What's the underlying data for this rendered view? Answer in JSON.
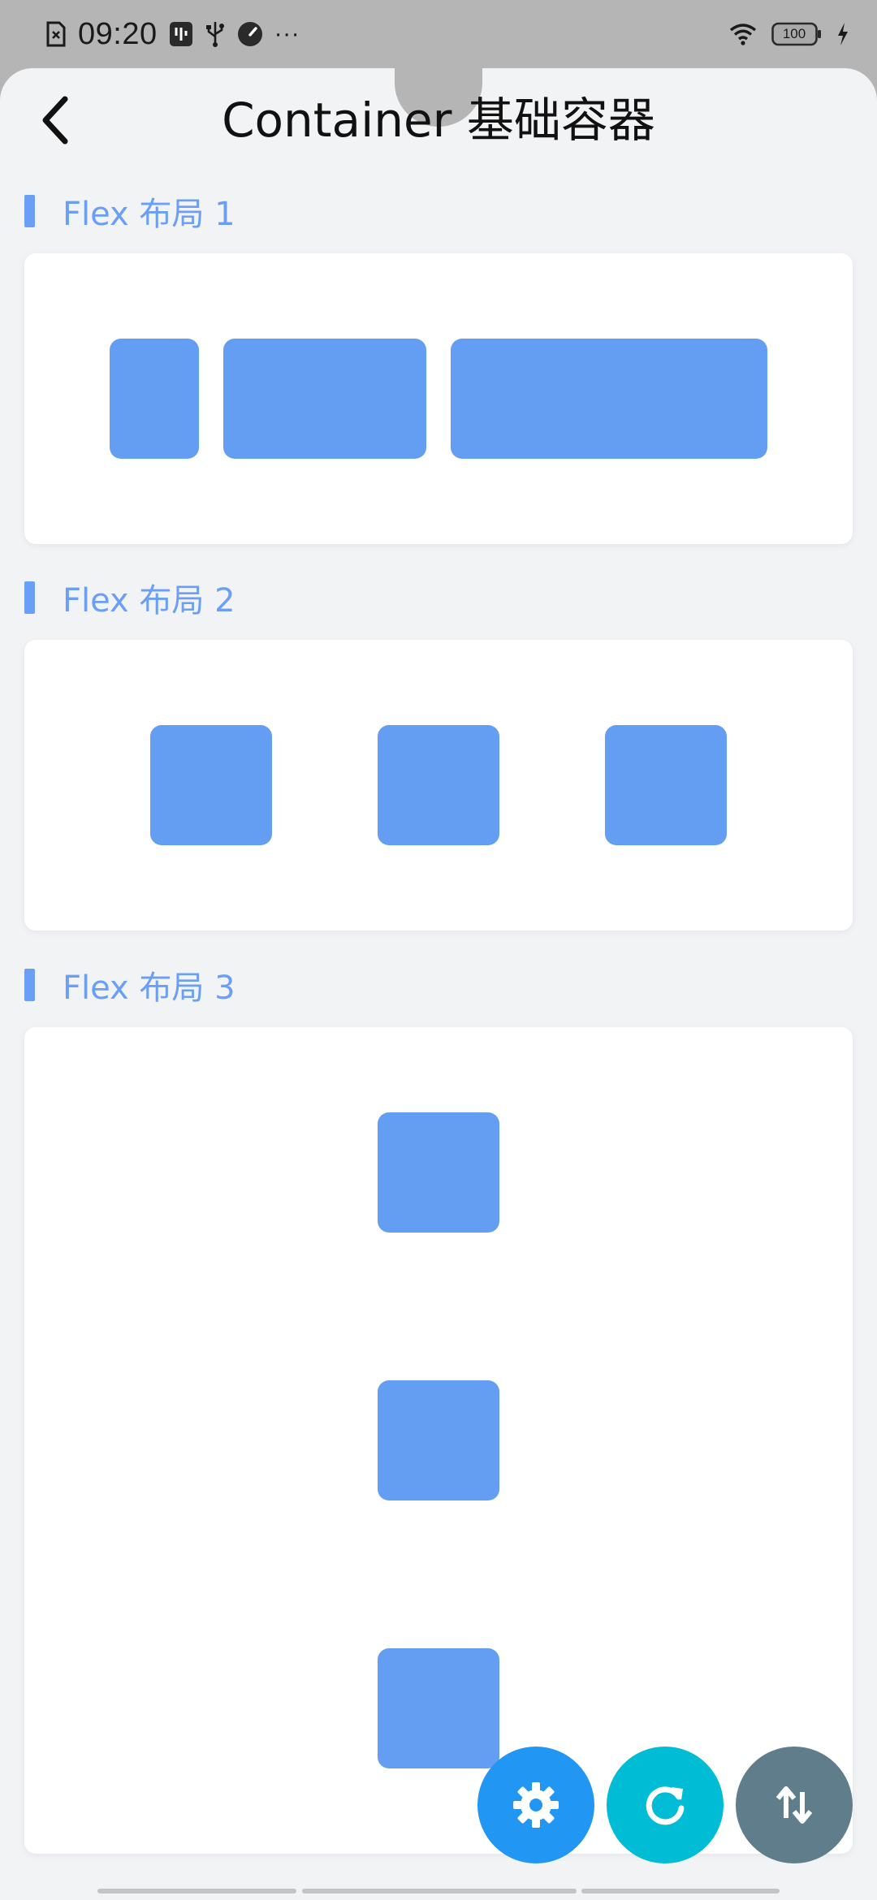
{
  "status": {
    "time": "09:20",
    "battery": "100",
    "more": "···"
  },
  "header": {
    "title": "Container 基础容器"
  },
  "sections": [
    {
      "label": "Flex 布局 1"
    },
    {
      "label": "Flex 布局 2"
    },
    {
      "label": "Flex 布局 3"
    }
  ],
  "colors": {
    "accent": "#6a9ff5",
    "block": "#649ef3",
    "fab_settings": "#2196f3",
    "fab_refresh": "#00bcd4",
    "fab_sort": "#607d8b"
  },
  "icons": {
    "back": "chevron-left-icon",
    "settings": "gear-icon",
    "refresh": "refresh-icon",
    "sort": "sort-arrows-icon"
  }
}
